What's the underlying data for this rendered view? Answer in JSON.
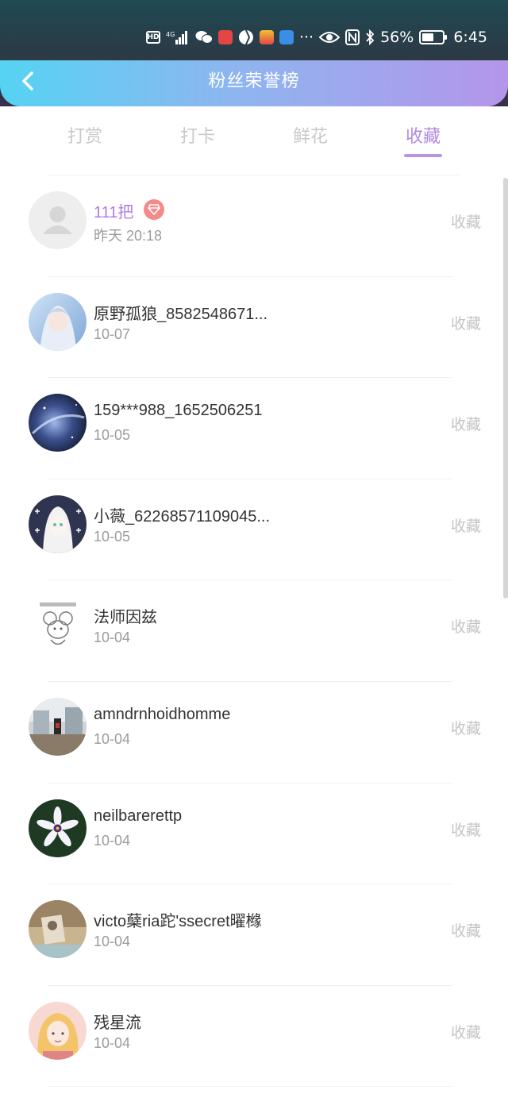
{
  "status_bar": {
    "network": "4G",
    "battery": "56%",
    "time": "6:45",
    "more": "···"
  },
  "header": {
    "title": "粉丝荣誉榜"
  },
  "tabs": [
    {
      "label": "打赏",
      "active": false
    },
    {
      "label": "打卡",
      "active": false
    },
    {
      "label": "鲜花",
      "active": false
    },
    {
      "label": "收藏",
      "active": true
    }
  ],
  "rows": [
    {
      "name": "111把",
      "date": "昨天 20:18",
      "action": "收藏",
      "avatar": "default-avatar",
      "badge": "diamond-badge"
    },
    {
      "name": "原野孤狼_8582548671...",
      "date": "10-07",
      "action": "收藏",
      "avatar": "anime-girl-avatar"
    },
    {
      "name": "159***988_1652506251",
      "date": "10-05",
      "action": "收藏",
      "avatar": "galaxy-avatar"
    },
    {
      "name": "小薇_62268571109045...",
      "date": "10-05",
      "action": "收藏",
      "avatar": "white-hair-anime-avatar"
    },
    {
      "name": "法师因兹",
      "date": "10-04",
      "action": "收藏",
      "avatar": "sketch-mouse-avatar"
    },
    {
      "name": "amndrnhoidhomme",
      "date": "10-04",
      "action": "收藏",
      "avatar": "street-photo-avatar"
    },
    {
      "name": "neilbarerettp",
      "date": "10-04",
      "action": "收藏",
      "avatar": "flower-avatar"
    },
    {
      "name": "victo蘖ria跎'ssecret曜橼",
      "date": "10-04",
      "action": "收藏",
      "avatar": "vintage-photo-avatar"
    },
    {
      "name": "残星流",
      "date": "10-04",
      "action": "收藏",
      "avatar": "illustrated-girl-avatar"
    }
  ]
}
